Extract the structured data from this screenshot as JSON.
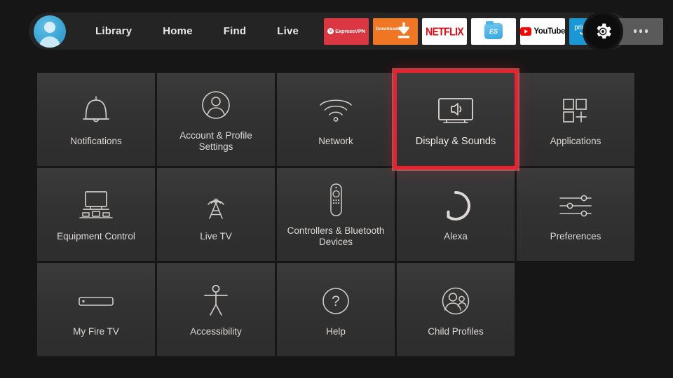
{
  "topnav": {
    "avatar_name": "profile-avatar",
    "links": [
      {
        "label": "Library"
      },
      {
        "label": "Home"
      },
      {
        "label": "Find"
      },
      {
        "label": "Live"
      }
    ],
    "apps": [
      {
        "name": "expressvpn",
        "label": "ExpressVPN"
      },
      {
        "name": "downloader",
        "label": "Downloader"
      },
      {
        "name": "netflix",
        "label": "NETFLIX"
      },
      {
        "name": "es-file-explorer",
        "label": "ES"
      },
      {
        "name": "youtube",
        "label": "YouTube"
      },
      {
        "name": "prime-video",
        "label": "prime video"
      },
      {
        "name": "more",
        "label": "..."
      }
    ],
    "settings_button": {
      "icon": "gear-icon",
      "label": "Settings"
    }
  },
  "settings_grid": {
    "rows": [
      [
        {
          "id": "notifications",
          "label": "Notifications",
          "icon": "bell-icon",
          "selected": false
        },
        {
          "id": "account-profile-settings",
          "label": "Account & Profile Settings",
          "icon": "person-circle-icon",
          "selected": false
        },
        {
          "id": "network",
          "label": "Network",
          "icon": "wifi-icon",
          "selected": false
        },
        {
          "id": "display-and-sounds",
          "label": "Display & Sounds",
          "icon": "tv-speaker-icon",
          "selected": true
        },
        {
          "id": "applications",
          "label": "Applications",
          "icon": "app-squares-plus-icon",
          "selected": false
        }
      ],
      [
        {
          "id": "equipment-control",
          "label": "Equipment Control",
          "icon": "tv-devices-icon",
          "selected": false
        },
        {
          "id": "live-tv",
          "label": "Live TV",
          "icon": "broadcast-tower-icon",
          "selected": false
        },
        {
          "id": "controllers-bluetooth-devices",
          "label": "Controllers & Bluetooth Devices",
          "icon": "remote-control-icon",
          "selected": false
        },
        {
          "id": "alexa",
          "label": "Alexa",
          "icon": "alexa-ring-icon",
          "selected": false
        },
        {
          "id": "preferences",
          "label": "Preferences",
          "icon": "sliders-icon",
          "selected": false
        }
      ],
      [
        {
          "id": "my-fire-tv",
          "label": "My Fire TV",
          "icon": "fire-tv-stick-icon",
          "selected": false
        },
        {
          "id": "accessibility",
          "label": "Accessibility",
          "icon": "accessibility-person-icon",
          "selected": false
        },
        {
          "id": "help",
          "label": "Help",
          "icon": "question-circle-icon",
          "selected": false
        },
        {
          "id": "child-profiles",
          "label": "Child Profiles",
          "icon": "two-people-circle-icon",
          "selected": false
        }
      ]
    ]
  },
  "colors": {
    "background": "#161616",
    "navbar": "#242424",
    "tile": "#343434",
    "selection": "#e8222e",
    "text": "#ddd9d6"
  }
}
